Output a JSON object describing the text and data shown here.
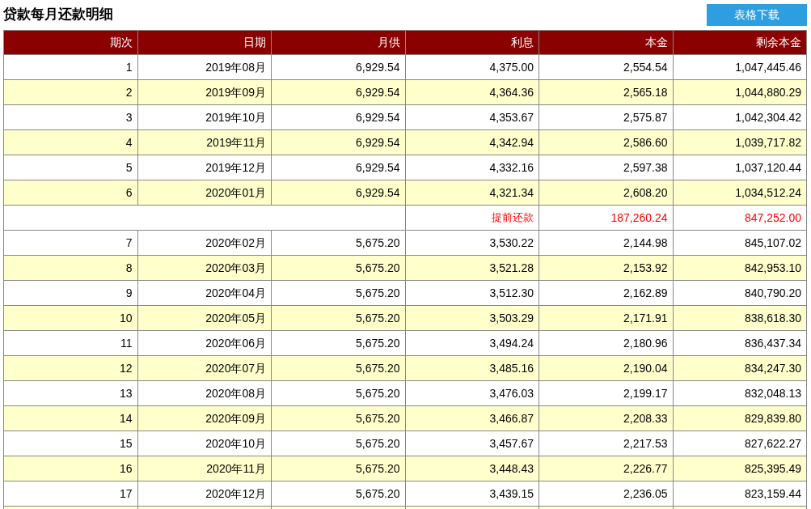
{
  "title": "贷款每月还款明细",
  "download_button": "表格下载",
  "table": {
    "columns": [
      "期次",
      "日期",
      "月供",
      "利息",
      "本金",
      "剩余本金"
    ],
    "rows": [
      {
        "kind": "installment",
        "cells": [
          "1",
          "2019年08月",
          "6,929.54",
          "4,375.00",
          "2,554.54",
          "1,047,445.46"
        ]
      },
      {
        "kind": "installment",
        "cells": [
          "2",
          "2019年09月",
          "6,929.54",
          "4,364.36",
          "2,565.18",
          "1,044,880.29"
        ]
      },
      {
        "kind": "installment",
        "cells": [
          "3",
          "2019年10月",
          "6,929.54",
          "4,353.67",
          "2,575.87",
          "1,042,304.42"
        ]
      },
      {
        "kind": "installment",
        "cells": [
          "4",
          "2019年11月",
          "6,929.54",
          "4,342.94",
          "2,586.60",
          "1,039,717.82"
        ]
      },
      {
        "kind": "installment",
        "cells": [
          "5",
          "2019年12月",
          "6,929.54",
          "4,332.16",
          "2,597.38",
          "1,037,120.44"
        ]
      },
      {
        "kind": "installment",
        "cells": [
          "6",
          "2020年01月",
          "6,929.54",
          "4,321.34",
          "2,608.20",
          "1,034,512.24"
        ]
      },
      {
        "kind": "prepayment",
        "cells": [
          "",
          "",
          "",
          "提前还款",
          "187,260.24",
          "847,252.00"
        ]
      },
      {
        "kind": "installment",
        "cells": [
          "7",
          "2020年02月",
          "5,675.20",
          "3,530.22",
          "2,144.98",
          "845,107.02"
        ]
      },
      {
        "kind": "installment",
        "cells": [
          "8",
          "2020年03月",
          "5,675.20",
          "3,521.28",
          "2,153.92",
          "842,953.10"
        ]
      },
      {
        "kind": "installment",
        "cells": [
          "9",
          "2020年04月",
          "5,675.20",
          "3,512.30",
          "2,162.89",
          "840,790.20"
        ]
      },
      {
        "kind": "installment",
        "cells": [
          "10",
          "2020年05月",
          "5,675.20",
          "3,503.29",
          "2,171.91",
          "838,618.30"
        ]
      },
      {
        "kind": "installment",
        "cells": [
          "11",
          "2020年06月",
          "5,675.20",
          "3,494.24",
          "2,180.96",
          "836,437.34"
        ]
      },
      {
        "kind": "installment",
        "cells": [
          "12",
          "2020年07月",
          "5,675.20",
          "3,485.16",
          "2,190.04",
          "834,247.30"
        ]
      },
      {
        "kind": "installment",
        "cells": [
          "13",
          "2020年08月",
          "5,675.20",
          "3,476.03",
          "2,199.17",
          "832,048.13"
        ]
      },
      {
        "kind": "installment",
        "cells": [
          "14",
          "2020年09月",
          "5,675.20",
          "3,466.87",
          "2,208.33",
          "829,839.80"
        ]
      },
      {
        "kind": "installment",
        "cells": [
          "15",
          "2020年10月",
          "5,675.20",
          "3,457.67",
          "2,217.53",
          "827,622.27"
        ]
      },
      {
        "kind": "installment",
        "cells": [
          "16",
          "2020年11月",
          "5,675.20",
          "3,448.43",
          "2,226.77",
          "825,395.49"
        ]
      },
      {
        "kind": "installment",
        "cells": [
          "17",
          "2020年12月",
          "5,675.20",
          "3,439.15",
          "2,236.05",
          "823,159.44"
        ]
      }
    ]
  }
}
